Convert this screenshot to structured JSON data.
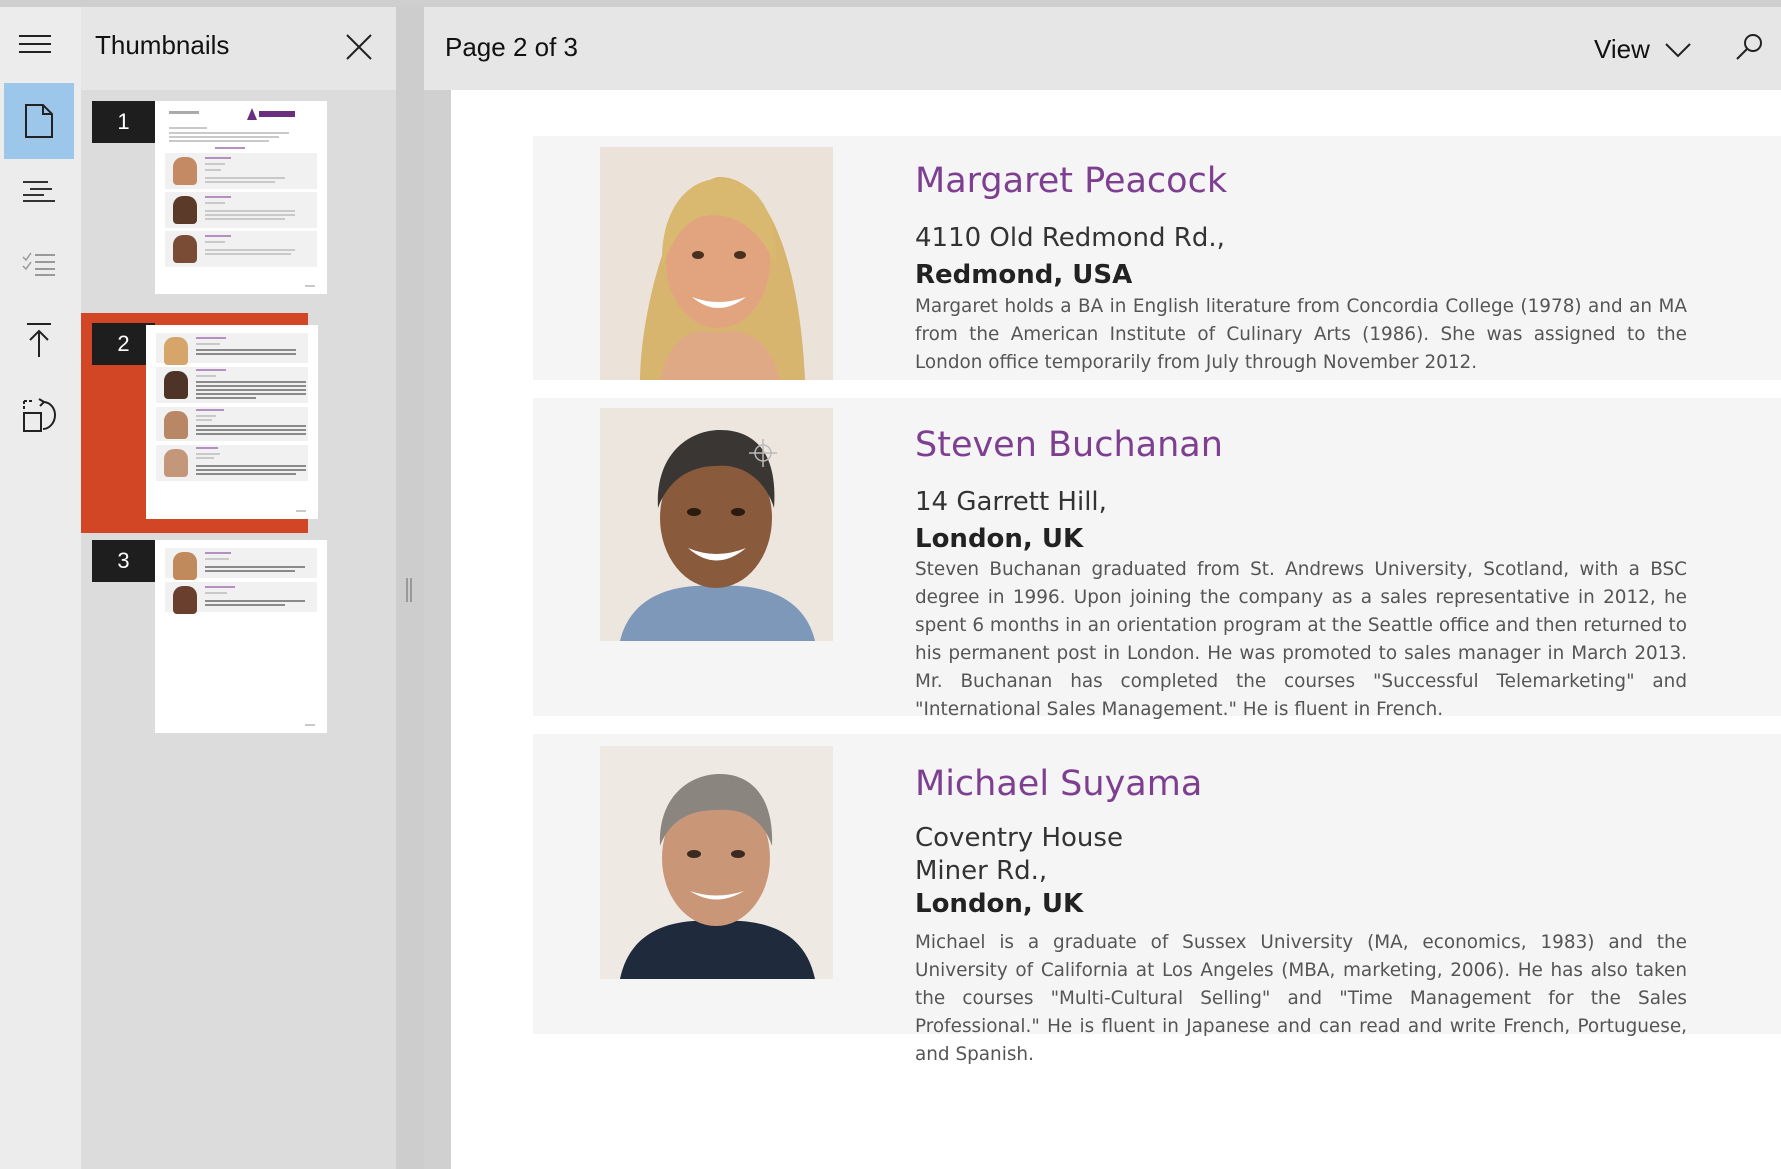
{
  "window": {
    "colors": {
      "accent_selected": "#d24626",
      "rail_active": "#9cc6ea",
      "name_color": "#7e3f91"
    }
  },
  "rail": {
    "items": [
      {
        "icon": "page-icon",
        "active": true
      },
      {
        "icon": "outline-icon",
        "active": false
      },
      {
        "icon": "checklist-icon",
        "active": false
      },
      {
        "icon": "go-to-top-icon",
        "active": false
      },
      {
        "icon": "rotate-page-icon",
        "active": false
      }
    ]
  },
  "thumbnails": {
    "title": "Thumbnails",
    "pages": [
      {
        "number": "1",
        "selected": false
      },
      {
        "number": "2",
        "selected": true
      },
      {
        "number": "3",
        "selected": false
      }
    ]
  },
  "header": {
    "page_label": "Page 2 of 3",
    "view_label": "View"
  },
  "employees": [
    {
      "name": "Margaret Peacock",
      "address1": "4110 Old Redmond Rd.,",
      "city": "Redmond, USA",
      "bio": "Margaret holds a BA in English literature from Concordia College (1978) and an MA from the American Institute of Culinary Arts (1986). She was assigned to the London office temporarily from July through November 2012."
    },
    {
      "name": "Steven Buchanan",
      "address1": "14 Garrett Hill,",
      "city": "London, UK",
      "bio": "Steven Buchanan graduated from St. Andrews University, Scotland, with a BSC degree in 1996. Upon joining the company as a sales representative in 2012, he spent 6 months in an orientation program at the Seattle office and then returned to his permanent post in London. He was promoted to sales manager in March 2013. Mr. Buchanan has completed the courses \"Successful Telemarketing\" and \"International Sales Management.\" He is fluent in French."
    },
    {
      "name": "Michael Suyama",
      "address1": "Coventry House",
      "address2": "Miner Rd.,",
      "city": "London, UK",
      "bio": "Michael is a graduate of Sussex University (MA, economics, 1983) and the University of California at Los Angeles (MBA, marketing, 2006). He has also taken the courses \"Multi-Cultural Selling\" and \"Time Management for the Sales Professional.\" He is fluent in Japanese and can read and write French, Portuguese, and Spanish."
    }
  ]
}
